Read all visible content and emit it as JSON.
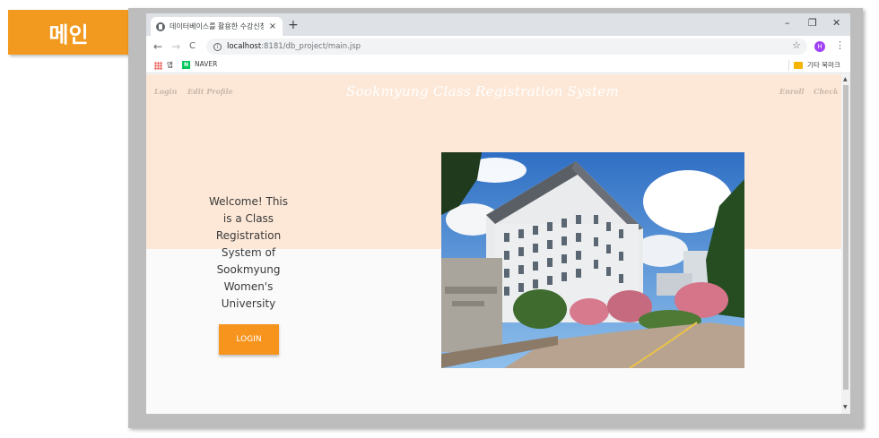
{
  "slide_label": "메인",
  "browser": {
    "tab_title": "데이터베이스를 활용한 수강신청",
    "tab_close": "×",
    "new_tab": "+",
    "controls": {
      "minimize": "–",
      "restore": "❐",
      "close": "✕"
    },
    "nav": {
      "back": "←",
      "forward": "→",
      "reload": "C"
    },
    "url_host": "localhost",
    "url_path": ":8181/db_project/main.jsp",
    "profile_initial": "H",
    "bookmarks": {
      "apps": "앱",
      "naver": "NAVER",
      "other": "기타 북마크"
    }
  },
  "site": {
    "nav_left": [
      "Login",
      "Edit Profile"
    ],
    "title": "Sookmyung Class Registration System",
    "nav_right": [
      "Enroll",
      "Check"
    ],
    "welcome": "Welcome! This is a Class Registration System of Sookmyung Women's University",
    "login_button": "LOGIN"
  },
  "colors": {
    "accent": "#f7941d",
    "hero_bg": "#fde8d7",
    "label_bg": "#f29a1f"
  }
}
